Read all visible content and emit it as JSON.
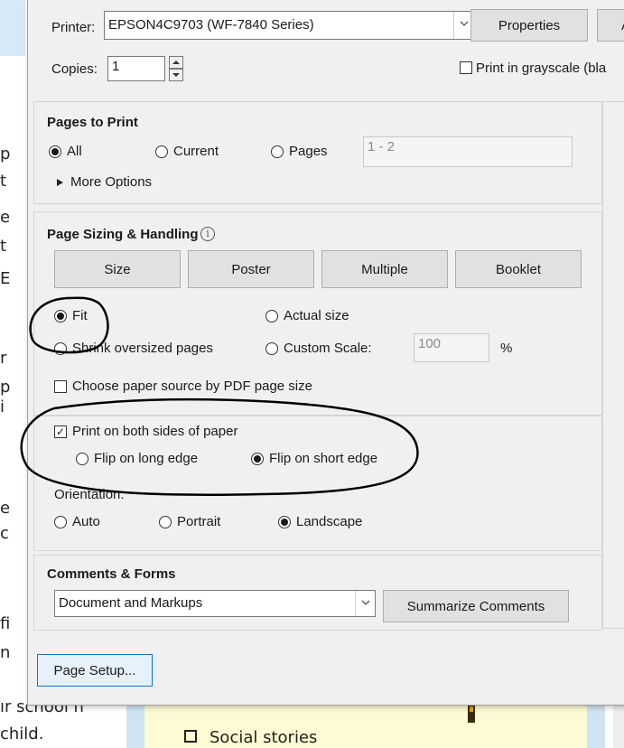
{
  "background_doc": {
    "fragments": [
      "p",
      "t",
      "e",
      "t",
      "E",
      "r",
      "p",
      "i",
      "e",
      "c",
      "fi",
      "n"
    ],
    "bottom_left_1": "ır school n",
    "bottom_left_2": "child.",
    "bottom_checklist_item": "Social stories"
  },
  "printer": {
    "label": "Printer:",
    "value": "EPSON4C9703 (WF-7840 Series)",
    "properties_label": "Properties",
    "advanced_label": "A"
  },
  "copies": {
    "label": "Copies:",
    "value": "1",
    "grayscale_label": "Print in grayscale (bla",
    "grayscale_checked": false
  },
  "pages_to_print": {
    "title": "Pages to Print",
    "options": [
      {
        "label": "All",
        "selected": true
      },
      {
        "label": "Current",
        "selected": false
      },
      {
        "label": "Pages",
        "selected": false
      }
    ],
    "pages_value": "1 - 2",
    "more_options_label": "More Options"
  },
  "page_sizing": {
    "title": "Page Sizing & Handling",
    "info_icon": "info-icon",
    "tabs": [
      "Size",
      "Poster",
      "Multiple",
      "Booklet"
    ],
    "fit_label": "Fit",
    "fit_selected": true,
    "actual_size_label": "Actual size",
    "shrink_label": "Shrink oversized pages",
    "custom_scale_label": "Custom Scale:",
    "custom_scale_value": "100",
    "percent": "%",
    "choose_paper_label": "Choose paper source by PDF page size",
    "choose_paper_checked": false
  },
  "duplex": {
    "both_sides_label": "Print on both sides of paper",
    "both_sides_checked": true,
    "flip_long_label": "Flip on long edge",
    "flip_short_label": "Flip on short edge",
    "flip_short_selected": true
  },
  "orientation": {
    "title": "Orientation:",
    "options": [
      {
        "label": "Auto",
        "selected": false
      },
      {
        "label": "Portrait",
        "selected": false
      },
      {
        "label": "Landscape",
        "selected": true
      }
    ]
  },
  "comments_forms": {
    "title": "Comments & Forms",
    "value": "Document and Markups",
    "summarize_label": "Summarize Comments"
  },
  "page_setup_label": "Page Setup...",
  "colors": {
    "dialog_bg": "#f0f0f0",
    "annotation_ink": "#000000",
    "focus_border": "#0078d7"
  }
}
